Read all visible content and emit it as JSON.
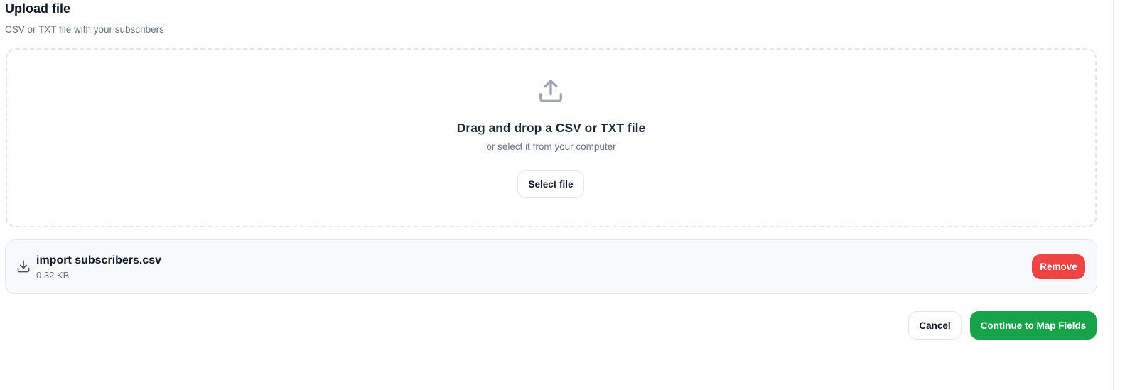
{
  "header": {
    "title": "Upload file",
    "subtitle": "CSV or TXT file with your subscribers"
  },
  "dropzone": {
    "icon": "upload-icon",
    "title": "Drag and drop a CSV or TXT file",
    "subtitle": "or select it from your computer",
    "select_label": "Select file"
  },
  "file": {
    "icon": "download-icon",
    "name": "import subscribers.csv",
    "size": "0.32 KB",
    "remove_label": "Remove"
  },
  "actions": {
    "cancel_label": "Cancel",
    "continue_label": "Continue to Map Fields"
  },
  "colors": {
    "remove": "#ef4444",
    "continue": "#16a34a",
    "muted_text": "#6b7280"
  }
}
